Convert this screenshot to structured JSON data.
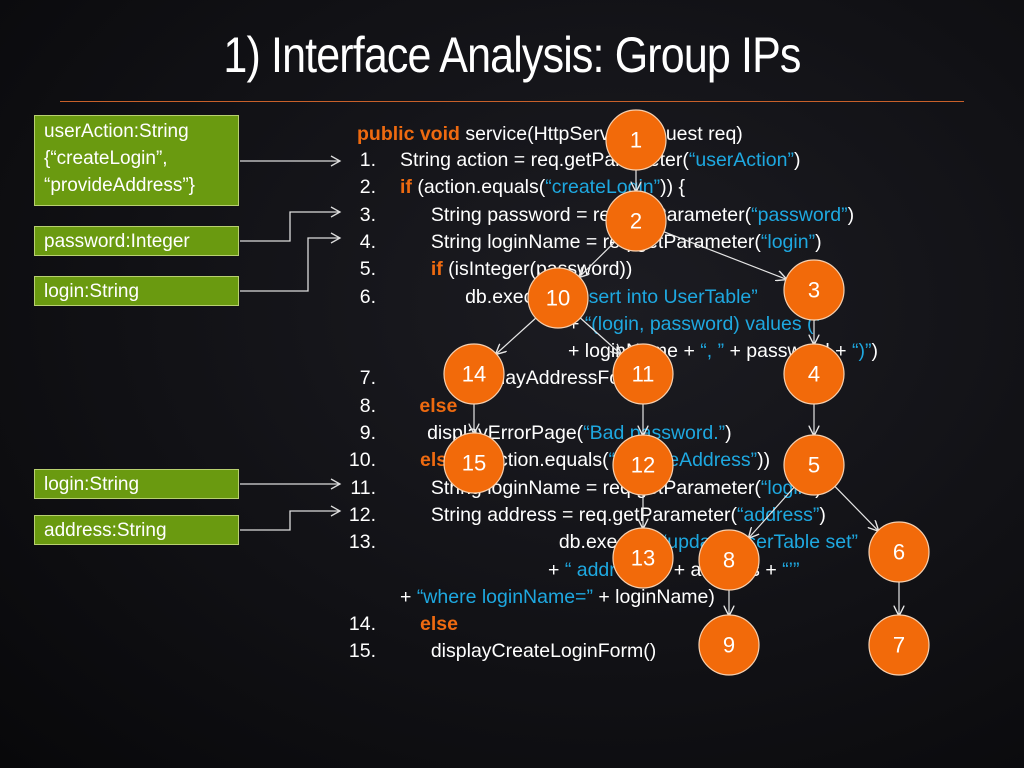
{
  "slide": {
    "title": "1) Interface Analysis: Group IPs",
    "colors": {
      "background": "#111115",
      "title_rule": "#c8602a",
      "param_box_fill": "#6a9a10",
      "keyword": "#ee6a10",
      "string_literal": "#1ea8e0",
      "node_fill": "#f26a0a",
      "text": "#ffffff"
    }
  },
  "params": [
    {
      "id": "p-useraction",
      "lines": [
        "userAction:String",
        "{“createLogin”,",
        "“provideAddress”}"
      ],
      "targets_line": "1"
    },
    {
      "id": "p-password",
      "lines": [
        "password:Integer"
      ],
      "targets_line": "3"
    },
    {
      "id": "p-login1",
      "lines": [
        "login:String"
      ],
      "targets_line": "4"
    },
    {
      "id": "p-login2",
      "lines": [
        "login:String"
      ],
      "targets_line": "11"
    },
    {
      "id": "p-address",
      "lines": [
        "address:String"
      ],
      "targets_line": "12"
    }
  ],
  "code": {
    "header": [
      {
        "t": "public void",
        "c": "kw"
      },
      {
        "t": " service(HttpServletRequest req)",
        "c": ""
      }
    ],
    "lines": [
      {
        "n": "1.",
        "segs": [
          {
            "t": "String action = req.getParameter(",
            "c": ""
          },
          {
            "t": "“userAction”",
            "c": "str"
          },
          {
            "t": ")",
            "c": ""
          }
        ]
      },
      {
        "n": "2.",
        "segs": [
          {
            "t": "if",
            "c": "kw"
          },
          {
            "t": " (action.equals(",
            "c": ""
          },
          {
            "t": "“createLogin”",
            "c": "str"
          },
          {
            "t": ")) {",
            "c": ""
          }
        ]
      },
      {
        "n": "3.",
        "segs": [
          {
            "t": "  String password = req.getParameter(",
            "c": ""
          },
          {
            "t": "“password”",
            "c": "str"
          },
          {
            "t": ")",
            "c": ""
          }
        ]
      },
      {
        "n": "4.",
        "segs": [
          {
            "t": "  String loginName = req.getParameter(",
            "c": ""
          },
          {
            "t": "“login”",
            "c": "str"
          },
          {
            "t": ")",
            "c": ""
          }
        ]
      },
      {
        "n": "5.",
        "segs": [
          {
            "t": "  ",
            "c": ""
          },
          {
            "t": "if",
            "c": "kw"
          },
          {
            "t": " (isInteger(password))",
            "c": ""
          }
        ]
      },
      {
        "n": "6.",
        "segs": [
          {
            "t": "     db.execute(",
            "c": ""
          },
          {
            "t": "“insert into UserTable”",
            "c": "str"
          }
        ]
      },
      {
        "n": "",
        "segs": [
          {
            "t": "+ ",
            "c": ""
          },
          {
            "t": "“(login, password) values (”",
            "c": "str"
          }
        ]
      },
      {
        "n": "",
        "segs": [
          {
            "t": "+ loginName + ",
            "c": ""
          },
          {
            "t": "“, ”",
            "c": "str"
          },
          {
            "t": " + password + ",
            "c": ""
          },
          {
            "t": "“)”",
            "c": "str"
          },
          {
            "t": ")",
            "c": ""
          }
        ]
      },
      {
        "n": "7.",
        "segs": [
          {
            "t": "     displayAddressForm()",
            "c": ""
          }
        ]
      },
      {
        "n": "8.",
        "segs": [
          {
            "t": " else",
            "c": "kw"
          }
        ]
      },
      {
        "n": "9.",
        "segs": [
          {
            "t": "     displayErrorPage(",
            "c": ""
          },
          {
            "t": "“Bad password.”",
            "c": "str"
          },
          {
            "t": ")",
            "c": ""
          }
        ]
      },
      {
        "n": "10.",
        "segs": [
          {
            "t": "else if",
            "c": "kw"
          },
          {
            "t": " (action.equals(",
            "c": ""
          },
          {
            "t": "“provideAddress”",
            "c": "str"
          },
          {
            "t": "))",
            "c": ""
          }
        ]
      },
      {
        "n": "11.",
        "segs": [
          {
            "t": "  String loginName = req.getParameter(",
            "c": ""
          },
          {
            "t": "“login”",
            "c": "str"
          },
          {
            "t": ")",
            "c": ""
          }
        ]
      },
      {
        "n": "12.",
        "segs": [
          {
            "t": "  String address = req.getParameter(",
            "c": ""
          },
          {
            "t": "“address”",
            "c": "str"
          },
          {
            "t": ")",
            "c": ""
          }
        ]
      },
      {
        "n": "13.",
        "segs": [
          {
            "t": "  db.execute(",
            "c": ""
          },
          {
            "t": "“update UserTable set”",
            "c": "str"
          }
        ]
      },
      {
        "n": "",
        "segs": [
          {
            "t": "+ ",
            "c": ""
          },
          {
            "t": "“ address=‘”",
            "c": "str"
          },
          {
            "t": " + address + ",
            "c": ""
          },
          {
            "t": "“’”",
            "c": "str"
          }
        ]
      },
      {
        "n": "",
        "segs": [
          {
            "t": "+ ",
            "c": ""
          },
          {
            "t": "“where loginName=”",
            "c": "str"
          },
          {
            "t": " + loginName)",
            "c": ""
          }
        ]
      },
      {
        "n": "14.",
        "segs": [
          {
            "t": "else",
            "c": "kw"
          }
        ]
      },
      {
        "n": "15.",
        "segs": [
          {
            "t": "  displayCreateLoginForm()",
            "c": ""
          }
        ]
      }
    ]
  },
  "graph": {
    "nodes": [
      "1",
      "2",
      "3",
      "4",
      "5",
      "6",
      "7",
      "8",
      "9",
      "10",
      "11",
      "12",
      "13",
      "14",
      "15"
    ],
    "edges": [
      [
        "1",
        "2"
      ],
      [
        "2",
        "3"
      ],
      [
        "2",
        "10"
      ],
      [
        "3",
        "4"
      ],
      [
        "4",
        "5"
      ],
      [
        "5",
        "6"
      ],
      [
        "5",
        "8"
      ],
      [
        "6",
        "7"
      ],
      [
        "8",
        "9"
      ],
      [
        "10",
        "14"
      ],
      [
        "10",
        "11"
      ],
      [
        "11",
        "12"
      ],
      [
        "12",
        "13"
      ],
      [
        "14",
        "15"
      ]
    ]
  }
}
